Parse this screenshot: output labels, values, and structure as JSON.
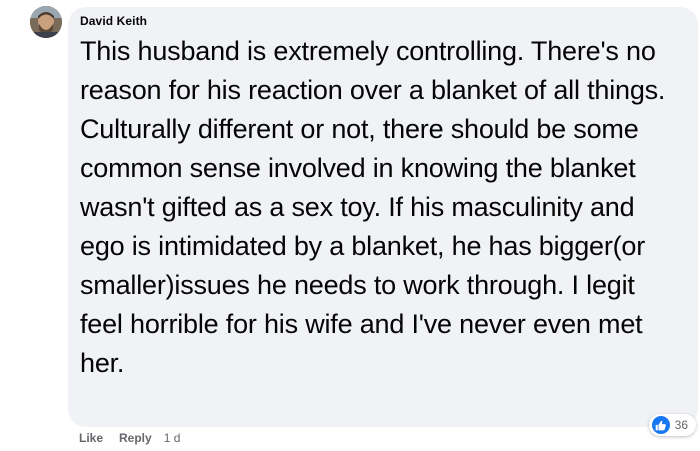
{
  "comment": {
    "author": "David Keith",
    "text": "This husband is extremely controlling. There's no reason for his reaction over a blanket of all things. Culturally different or not, there should be some common sense involved in knowing the blanket wasn't gifted as a sex toy. If his masculinity and ego is intimidated by a blanket, he has bigger(or smaller)issues he needs to work through. I legit feel horrible for his wife and I've never even met her.",
    "reaction_icon": "thumbs-up-icon",
    "reaction_count": "36",
    "actions": {
      "like": "Like",
      "reply": "Reply",
      "time": "1 d"
    }
  },
  "colors": {
    "bubble": "#f0f2f5",
    "secondary_text": "#65676b",
    "like_blue": "#1877f2"
  }
}
